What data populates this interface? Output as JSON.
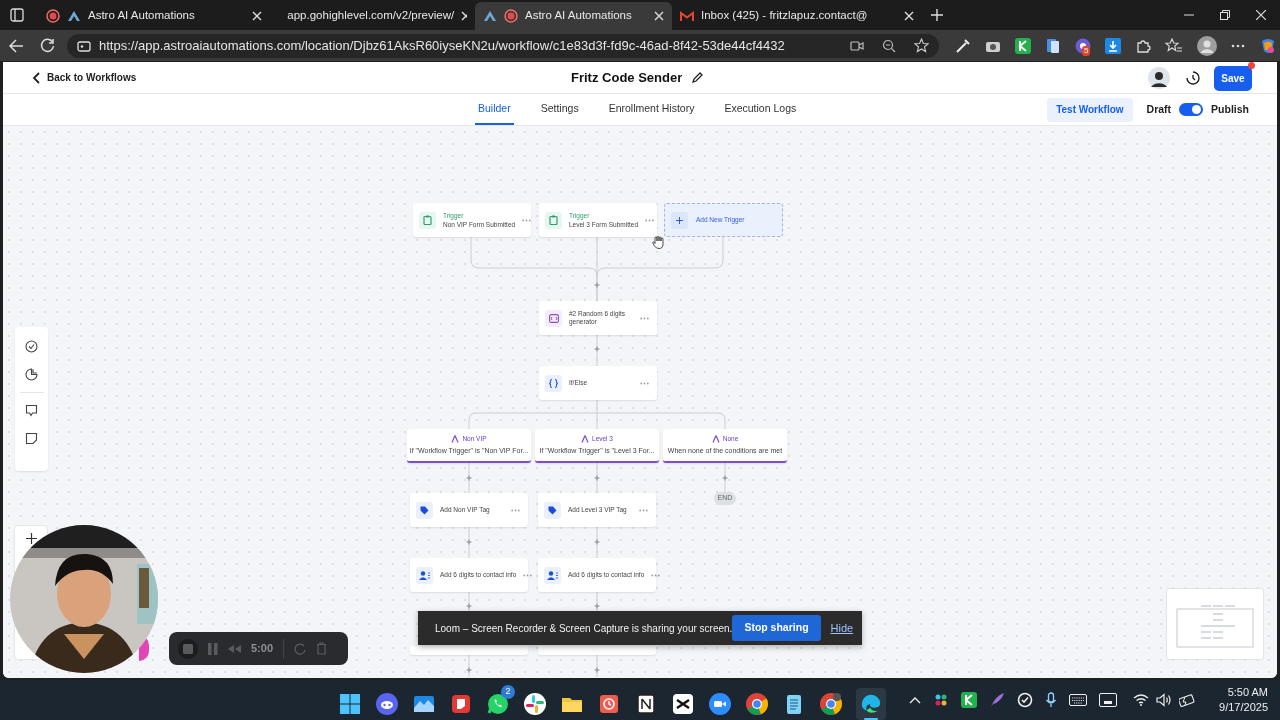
{
  "browser": {
    "tabs": [
      {
        "title": "Astro AI Automations",
        "selected": false,
        "recording": true,
        "kind": "astro"
      },
      {
        "title": "app.gohighlevel.com/v2/preview/",
        "selected": false,
        "recording": false,
        "kind": "plain"
      },
      {
        "title": "Astro AI Automations",
        "selected": true,
        "recording": true,
        "kind": "astro"
      },
      {
        "title": "Inbox (425) - fritzlapuz.contact@",
        "selected": false,
        "recording": false,
        "kind": "mail"
      }
    ],
    "url": "https://app.astroaiautomations.com/location/Djbz61AksR60iyseKN2u/workflow/c1e83d3f-fd9c-46ad-8f42-53de44cf4432",
    "extension_badge": "5"
  },
  "header": {
    "back_link": "Back to Workflows",
    "title": "Fritz Code Sender",
    "save": "Save",
    "nav": [
      {
        "label": "Builder",
        "selected": true
      },
      {
        "label": "Settings",
        "selected": false
      },
      {
        "label": "Enrollment History",
        "selected": false
      },
      {
        "label": "Execution Logs",
        "selected": false
      }
    ],
    "test_button": "Test Workflow",
    "draft_label": "Draft",
    "publish_toggle": {
      "on": true
    },
    "publish_label": "Publish"
  },
  "workflow": {
    "triggers": [
      {
        "label": "Trigger",
        "name": "Non VIP Form Submitted"
      },
      {
        "label": "Trigger",
        "name": "Level 3 Form Submitted"
      }
    ],
    "add_trigger": "Add New Trigger",
    "steps": [
      {
        "kind": "code",
        "name": "#2 Random 6 digits generator"
      },
      {
        "kind": "condition",
        "name": "If/Else"
      }
    ],
    "branches": [
      {
        "name": "Non VIP",
        "condition": "If \"Workflow Trigger\" is \"Non VIP For...",
        "actions": [
          {
            "kind": "tag",
            "name": "Add Non VIP Tag"
          },
          {
            "kind": "contact",
            "name": "Add 6 digits to contact info"
          }
        ]
      },
      {
        "name": "Level 3",
        "condition": "If \"Workflow Trigger\" is \"Level 3 For...",
        "actions": [
          {
            "kind": "tag",
            "name": "Add Level 3 VIP Tag"
          },
          {
            "kind": "contact",
            "name": "Add 6 digits to contact info"
          }
        ]
      },
      {
        "name": "None",
        "condition": "When none of the conditions are met",
        "end": "END"
      }
    ]
  },
  "loom_banner": {
    "message": "Loom – Screen Recorder & Screen Capture is sharing your screen.",
    "stop": "Stop sharing",
    "hide": "Hide"
  },
  "recorder": {
    "time": "5:00"
  },
  "taskbar": {
    "whatsapp_badge": "2",
    "time": "5:50 AM",
    "date": "9/17/2025"
  }
}
